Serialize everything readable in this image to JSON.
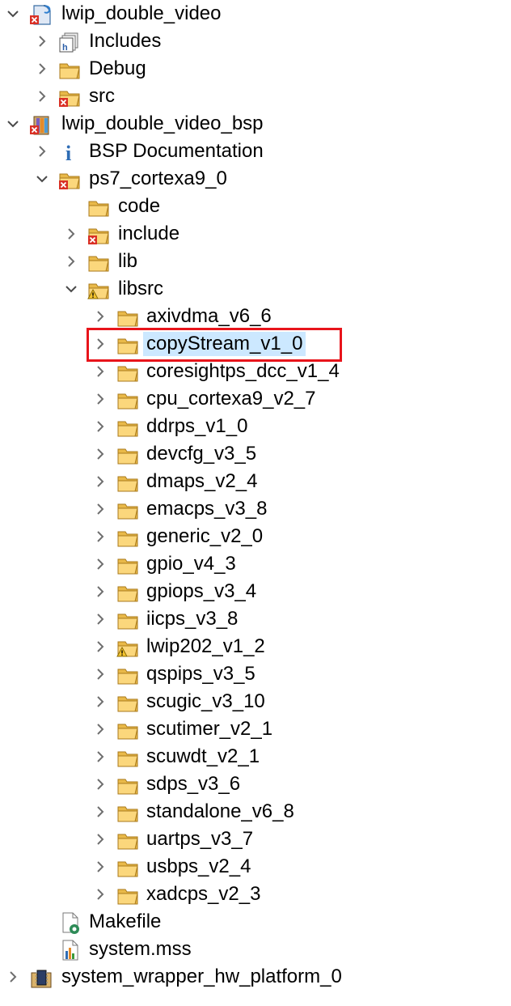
{
  "tree": {
    "items": [
      {
        "label": "lwip_double_video",
        "depth": 0,
        "expand": "expanded",
        "icon": "project-error-icon"
      },
      {
        "label": "Includes",
        "depth": 1,
        "expand": "collapsed",
        "icon": "includes-icon"
      },
      {
        "label": "Debug",
        "depth": 1,
        "expand": "collapsed",
        "icon": "folder-icon"
      },
      {
        "label": "src",
        "depth": 1,
        "expand": "collapsed",
        "icon": "folder-error-icon"
      },
      {
        "label": "lwip_double_video_bsp",
        "depth": 0,
        "expand": "expanded",
        "icon": "bsp-project-error-icon"
      },
      {
        "label": "BSP Documentation",
        "depth": 1,
        "expand": "collapsed",
        "icon": "info-icon"
      },
      {
        "label": "ps7_cortexa9_0",
        "depth": 1,
        "expand": "expanded",
        "icon": "folder-error-icon"
      },
      {
        "label": "code",
        "depth": 2,
        "expand": "none",
        "icon": "folder-icon"
      },
      {
        "label": "include",
        "depth": 2,
        "expand": "collapsed",
        "icon": "folder-error-icon"
      },
      {
        "label": "lib",
        "depth": 2,
        "expand": "collapsed",
        "icon": "folder-icon"
      },
      {
        "label": "libsrc",
        "depth": 2,
        "expand": "expanded",
        "icon": "folder-warning-icon"
      },
      {
        "label": "axivdma_v6_6",
        "depth": 3,
        "expand": "collapsed",
        "icon": "folder-icon"
      },
      {
        "label": "copyStream_v1_0",
        "depth": 3,
        "expand": "collapsed",
        "icon": "folder-icon",
        "selected": true
      },
      {
        "label": "coresightps_dcc_v1_4",
        "depth": 3,
        "expand": "collapsed",
        "icon": "folder-icon"
      },
      {
        "label": "cpu_cortexa9_v2_7",
        "depth": 3,
        "expand": "collapsed",
        "icon": "folder-icon"
      },
      {
        "label": "ddrps_v1_0",
        "depth": 3,
        "expand": "collapsed",
        "icon": "folder-icon"
      },
      {
        "label": "devcfg_v3_5",
        "depth": 3,
        "expand": "collapsed",
        "icon": "folder-icon"
      },
      {
        "label": "dmaps_v2_4",
        "depth": 3,
        "expand": "collapsed",
        "icon": "folder-icon"
      },
      {
        "label": "emacps_v3_8",
        "depth": 3,
        "expand": "collapsed",
        "icon": "folder-icon"
      },
      {
        "label": "generic_v2_0",
        "depth": 3,
        "expand": "collapsed",
        "icon": "folder-icon"
      },
      {
        "label": "gpio_v4_3",
        "depth": 3,
        "expand": "collapsed",
        "icon": "folder-icon"
      },
      {
        "label": "gpiops_v3_4",
        "depth": 3,
        "expand": "collapsed",
        "icon": "folder-icon"
      },
      {
        "label": "iicps_v3_8",
        "depth": 3,
        "expand": "collapsed",
        "icon": "folder-icon"
      },
      {
        "label": "lwip202_v1_2",
        "depth": 3,
        "expand": "collapsed",
        "icon": "folder-warning-icon"
      },
      {
        "label": "qspips_v3_5",
        "depth": 3,
        "expand": "collapsed",
        "icon": "folder-icon"
      },
      {
        "label": "scugic_v3_10",
        "depth": 3,
        "expand": "collapsed",
        "icon": "folder-icon"
      },
      {
        "label": "scutimer_v2_1",
        "depth": 3,
        "expand": "collapsed",
        "icon": "folder-icon"
      },
      {
        "label": "scuwdt_v2_1",
        "depth": 3,
        "expand": "collapsed",
        "icon": "folder-icon"
      },
      {
        "label": "sdps_v3_6",
        "depth": 3,
        "expand": "collapsed",
        "icon": "folder-icon"
      },
      {
        "label": "standalone_v6_8",
        "depth": 3,
        "expand": "collapsed",
        "icon": "folder-icon"
      },
      {
        "label": "uartps_v3_7",
        "depth": 3,
        "expand": "collapsed",
        "icon": "folder-icon"
      },
      {
        "label": "usbps_v2_4",
        "depth": 3,
        "expand": "collapsed",
        "icon": "folder-icon"
      },
      {
        "label": "xadcps_v2_3",
        "depth": 3,
        "expand": "collapsed",
        "icon": "folder-icon"
      },
      {
        "label": "Makefile",
        "depth": 1,
        "expand": "none",
        "icon": "makefile-icon"
      },
      {
        "label": "system.mss",
        "depth": 1,
        "expand": "none",
        "icon": "mss-file-icon"
      },
      {
        "label": "system_wrapper_hw_platform_0",
        "depth": 0,
        "expand": "collapsed",
        "icon": "hw-platform-icon"
      }
    ]
  },
  "colors": {
    "selection": "#cce8ff",
    "highlight_box": "#e8141b",
    "folder": "#f5c86a",
    "error_badge": "#d93025"
  }
}
